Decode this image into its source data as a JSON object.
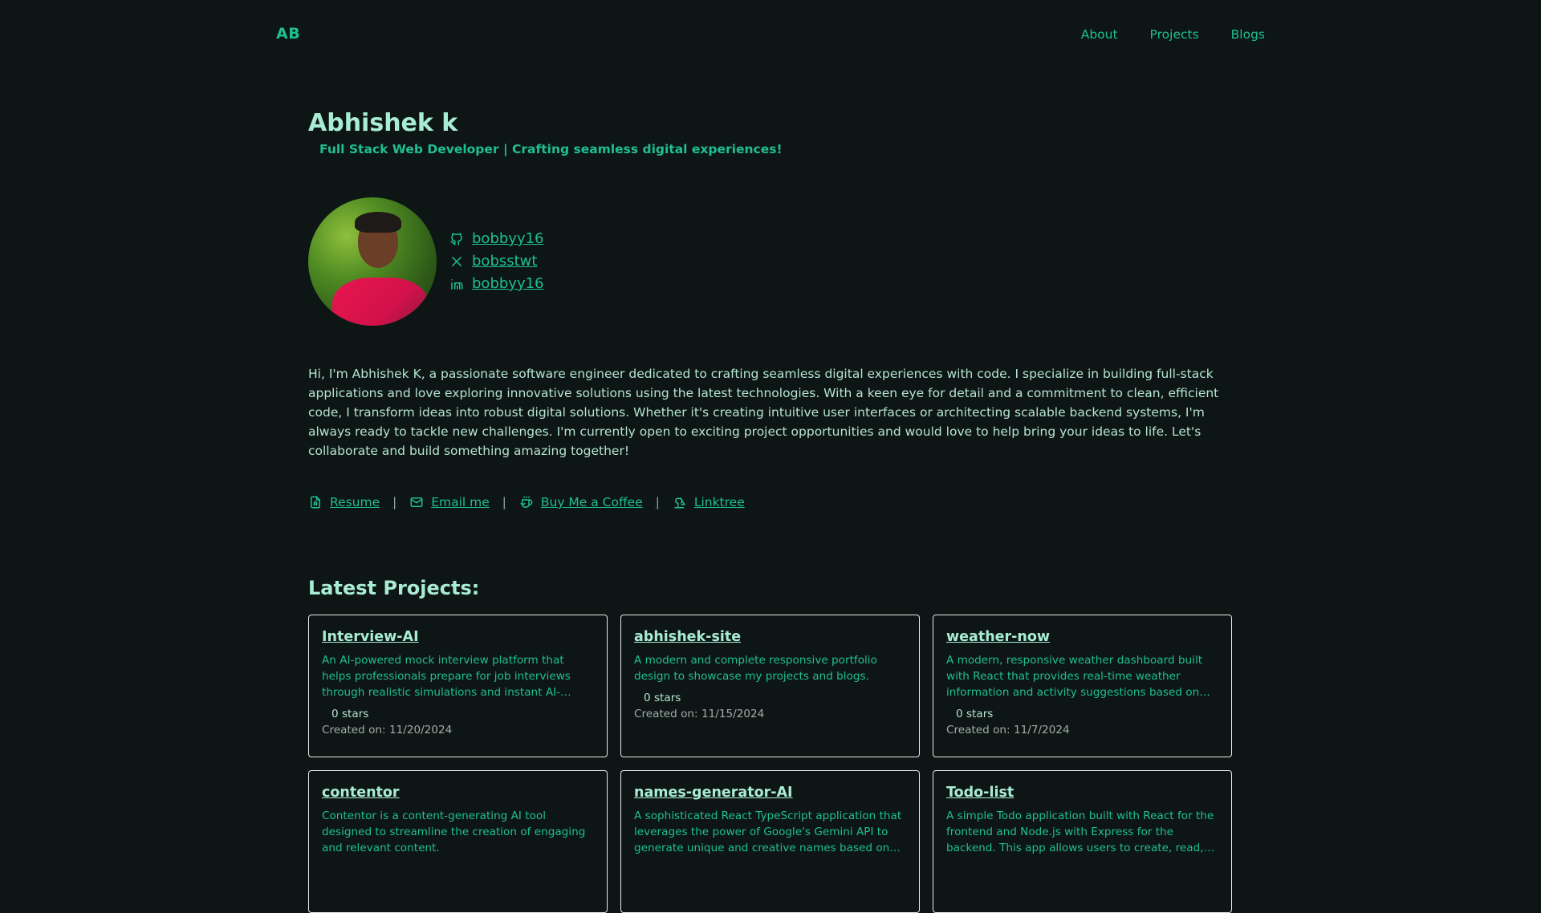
{
  "header": {
    "logo": "AB",
    "nav": [
      {
        "label": "About"
      },
      {
        "label": "Projects"
      },
      {
        "label": "Blogs"
      }
    ]
  },
  "hero": {
    "name": "Abhishek k",
    "tagline": "Full Stack Web Developer | Crafting seamless digital experiences!"
  },
  "socials": [
    {
      "icon": "github-icon",
      "handle": "bobbyy16"
    },
    {
      "icon": "x-icon",
      "handle": "bobsstwt"
    },
    {
      "icon": "linkedin-icon",
      "handle": "bobbyy16"
    }
  ],
  "bio": "Hi, I'm Abhishek K, a passionate software engineer dedicated to crafting seamless digital experiences with code. I specialize in building full-stack applications and love exploring innovative solutions using the latest technologies. With a keen eye for detail and a commitment to clean, efficient code, I transform ideas into robust digital solutions. Whether it's creating intuitive user interfaces or architecting scalable backend systems, I'm always ready to tackle new challenges. I'm currently open to exciting project opportunities and would love to help bring your ideas to life. Let's collaborate and build something amazing together!",
  "links": [
    {
      "icon": "resume-icon",
      "label": "Resume"
    },
    {
      "icon": "mail-icon",
      "label": "Email me"
    },
    {
      "icon": "coffee-icon",
      "label": "Buy Me a Coffee"
    },
    {
      "icon": "tree-icon",
      "label": "Linktree"
    }
  ],
  "separator": "|",
  "projects": {
    "title": "Latest Projects:",
    "items": [
      {
        "name": "Interview-AI",
        "description": "An AI-powered mock interview platform that helps professionals prepare for job interviews through realistic simulations and instant AI-generated feedback.",
        "stars": "0 stars",
        "created": "Created on: 11/20/2024"
      },
      {
        "name": "abhishek-site",
        "description": "A modern and complete responsive portfolio design to showcase my projects and blogs.",
        "stars": "0 stars",
        "created": "Created on: 11/15/2024"
      },
      {
        "name": "weather-now",
        "description": "A modern, responsive weather dashboard built with React that provides real-time weather information and activity suggestions based on current weather conditions.",
        "stars": "0 stars",
        "created": "Created on: 11/7/2024"
      },
      {
        "name": "contentor",
        "description": "Contentor is a content-generating AI tool designed to streamline the creation of engaging and relevant content.",
        "stars": "",
        "created": ""
      },
      {
        "name": "names-generator-AI",
        "description": "A sophisticated React TypeScript application that leverages the power of Google's Gemini API to generate unique and creative names based on user input.",
        "stars": "",
        "created": ""
      },
      {
        "name": "Todo-list",
        "description": "A simple Todo application built with React for the frontend and Node.js with Express for the backend. This app allows users to create, read, update, and delete tasks.",
        "stars": "",
        "created": ""
      }
    ]
  },
  "colors": {
    "background": "#0d1614",
    "accent": "#1fbf94",
    "heading": "#a9ecd6",
    "body_text": "#b5e3d3",
    "muted": "#a3aca9",
    "card_border": "#e6ecea"
  }
}
